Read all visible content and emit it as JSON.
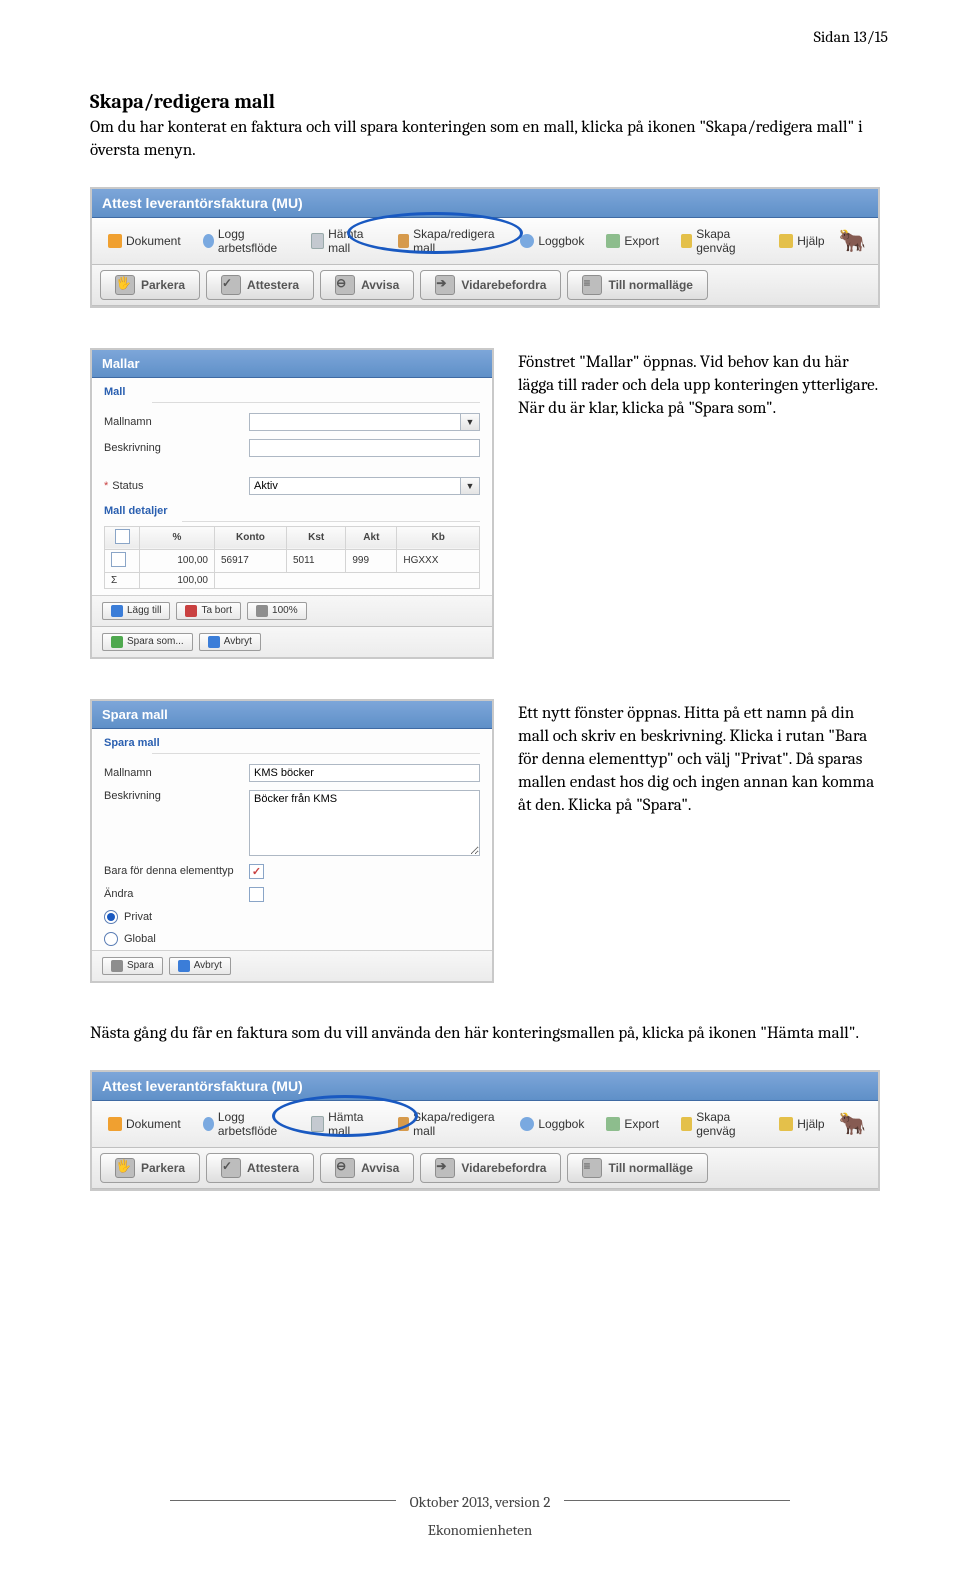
{
  "page_number": "Sidan 13/15",
  "section_title": "Skapa/redigera mall",
  "intro_text": "Om du har konterat en faktura och vill spara konteringen som en mall, klicka på ikonen \"Skapa/redigera mall\" i översta menyn.",
  "app_title": "Attest leverantörsfaktura (MU)",
  "toolbar": {
    "dokument": "Dokument",
    "logg": "Logg arbetsflöde",
    "hamta_mall": "Hämta mall",
    "skapa_mall": "Skapa/redigera mall",
    "loggbok": "Loggbok",
    "export": "Export",
    "genvag": "Skapa genväg",
    "hjalp": "Hjälp"
  },
  "subtoolbar": {
    "parkera": "Parkera",
    "attestera": "Attestera",
    "avvisa": "Avvisa",
    "vidarebefordra": "Vidarebefordra",
    "normallage": "Till normalläge"
  },
  "para2": "Fönstret \"Mallar\" öppnas. Vid behov kan du här lägga till rader och dela upp konteringen ytterligare. När du är klar, klicka på \"Spara som\".",
  "mallar_panel": {
    "title": "Mallar",
    "section": "Mall",
    "mallnamn_label": "Mallnamn",
    "beskrivning_label": "Beskrivning",
    "status_label": "Status",
    "status_value": "Aktiv",
    "detaljer_label": "Mall detaljer",
    "cols": {
      "pct": "%",
      "konto": "Konto",
      "kst": "Kst",
      "akt": "Akt",
      "kb": "Kb"
    },
    "row": {
      "pct": "100,00",
      "konto": "56917",
      "kst": "5011",
      "akt": "999",
      "kb": "HGXXX"
    },
    "sum": {
      "sigma": "Σ",
      "pct": "100,00"
    },
    "lagg_till": "Lägg till",
    "ta_bort": "Ta bort",
    "pct_btn": "100%",
    "spara_som": "Spara som...",
    "avbryt": "Avbryt"
  },
  "para3": "Ett nytt fönster öppnas. Hitta på ett namn på din mall och skriv en beskrivning. Klicka i rutan \"Bara för denna elementtyp\" och välj \"Privat\". Då sparas mallen endast hos dig och ingen annan kan komma åt den. Klicka på \"Spara\".",
  "spara_panel": {
    "title": "Spara mall",
    "section": "Spara mall",
    "mallnamn_label": "Mallnamn",
    "mallnamn_value": "KMS böcker",
    "beskrivning_label": "Beskrivning",
    "beskrivning_value": "Böcker från KMS",
    "elementtype_label": "Bara för denna elementtyp",
    "andra_label": "Ändra",
    "privat_label": "Privat",
    "global_label": "Global",
    "spara": "Spara",
    "avbryt": "Avbryt"
  },
  "para4": "Nästa gång du får en faktura som du vill använda den här konteringsmallen på, klicka på ikonen \"Hämta mall\".",
  "footer": {
    "line1": "Oktober 2013, version 2",
    "line2": "Ekonomienheten"
  },
  "icon_colors": {
    "dokument": "#f0a030",
    "logg": "#7aa9e0",
    "hamta_mall": "#c4c9d0",
    "skapa_mall": "#d69a4c",
    "loggbok": "#7aa9e0",
    "export": "#8dbd8d",
    "genvag": "#e4c04a",
    "hjalp": "#e4c04a"
  }
}
